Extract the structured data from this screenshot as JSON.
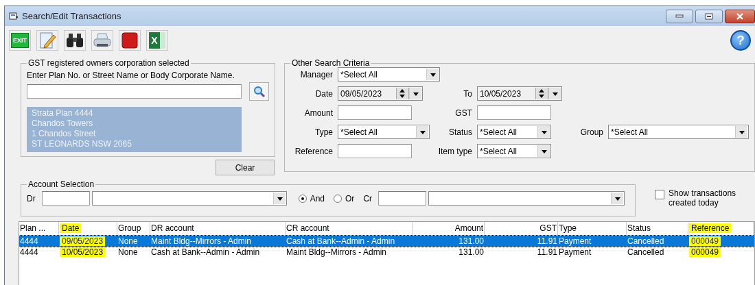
{
  "window": {
    "title": "Search/Edit Transactions"
  },
  "toolbar": [
    {
      "kind": "exit",
      "label": "EXIT"
    },
    {
      "kind": "edit"
    },
    {
      "kind": "find"
    },
    {
      "kind": "print"
    },
    {
      "kind": "stop"
    },
    {
      "kind": "excel",
      "label": "X"
    }
  ],
  "help": {
    "label": "?"
  },
  "gst_group": {
    "title": "GST registered owners corporation selected",
    "prompt": "Enter Plan No. or Street Name or Body Corporate Name.",
    "address_lines": [
      "Strata Plan 4444",
      "Chandos Towers",
      "1 Chandos Street",
      "ST LEONARDS  NSW  2065"
    ],
    "clear_button": "Clear"
  },
  "criteria": {
    "title": "Other Search Criteria",
    "manager": {
      "label": "Manager",
      "value": "*Select All"
    },
    "date": {
      "label": "Date",
      "value": "09/05/2023"
    },
    "to": {
      "label": "To",
      "value": "10/05/2023"
    },
    "amount": {
      "label": "Amount"
    },
    "gst": {
      "label": "GST"
    },
    "type": {
      "label": "Type",
      "value": "*Select All"
    },
    "status": {
      "label": "Status",
      "value": "*Select All"
    },
    "group": {
      "label": "Group",
      "value": "*Select All"
    },
    "reference": {
      "label": "Reference"
    },
    "item_type": {
      "label": "Item type",
      "value": "*Select All"
    }
  },
  "account": {
    "title": "Account Selection",
    "dr_label": "Dr",
    "logic": [
      {
        "label": "And",
        "selected": true
      },
      {
        "label": "Or",
        "selected": false
      }
    ],
    "cr_label": "Cr"
  },
  "show_today": {
    "label": "Show transactions created today",
    "checked": false
  },
  "table": {
    "columns": [
      {
        "label": "Plan ...",
        "highlighted": false
      },
      {
        "label": "Date",
        "highlighted": true
      },
      {
        "label": "Group",
        "highlighted": false
      },
      {
        "label": "DR account",
        "highlighted": false
      },
      {
        "label": "CR account",
        "highlighted": false
      },
      {
        "label": "Amount",
        "highlighted": false
      },
      {
        "label": "GST",
        "highlighted": false
      },
      {
        "label": "Type",
        "highlighted": false
      },
      {
        "label": "Status",
        "highlighted": false
      },
      {
        "label": "Reference",
        "highlighted": true
      }
    ],
    "rows": [
      {
        "selected": true,
        "cells": [
          "4444",
          "09/05/2023",
          "None",
          "Maint Bldg--Mirrors - Admin",
          "Cash at Bank--Admin - Admin",
          "131.00",
          "11.91",
          "Payment",
          "Cancelled",
          "000049"
        ]
      },
      {
        "selected": false,
        "cells": [
          "4444",
          "10/05/2023",
          "None",
          "Cash at Bank--Admin - Admin",
          "Maint Bldg--Mirrors - Admin",
          "131.00",
          "11.91",
          "Payment",
          "Cancelled",
          "000049"
        ]
      }
    ]
  }
}
